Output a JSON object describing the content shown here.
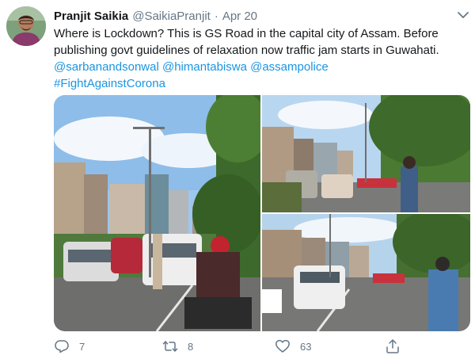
{
  "author": {
    "name": "Pranjit Saikia",
    "handle": "@SaikiaPranjit",
    "separator": "·",
    "date": "Apr 20"
  },
  "tweet": {
    "line1": "Where is Lockdown? This is GS Road in the capital city of Assam. Before",
    "line2": "publishing govt guidelines of relaxation now traffic jam starts in Guwahati.",
    "mentions": [
      "@sarbanandsonwal",
      "@himantabiswa",
      "@assampolice"
    ],
    "hashtag": "#FightAgainstCorona"
  },
  "actions": {
    "reply_count": "7",
    "retweet_count": "8",
    "like_count": "63"
  },
  "icons": {
    "caret": "chevron-down-icon",
    "reply": "reply-icon",
    "retweet": "retweet-icon",
    "like": "heart-icon",
    "share": "share-icon"
  },
  "colors": {
    "link": "#1b95e0",
    "secondary_text": "#657786",
    "primary_text": "#14171a"
  }
}
